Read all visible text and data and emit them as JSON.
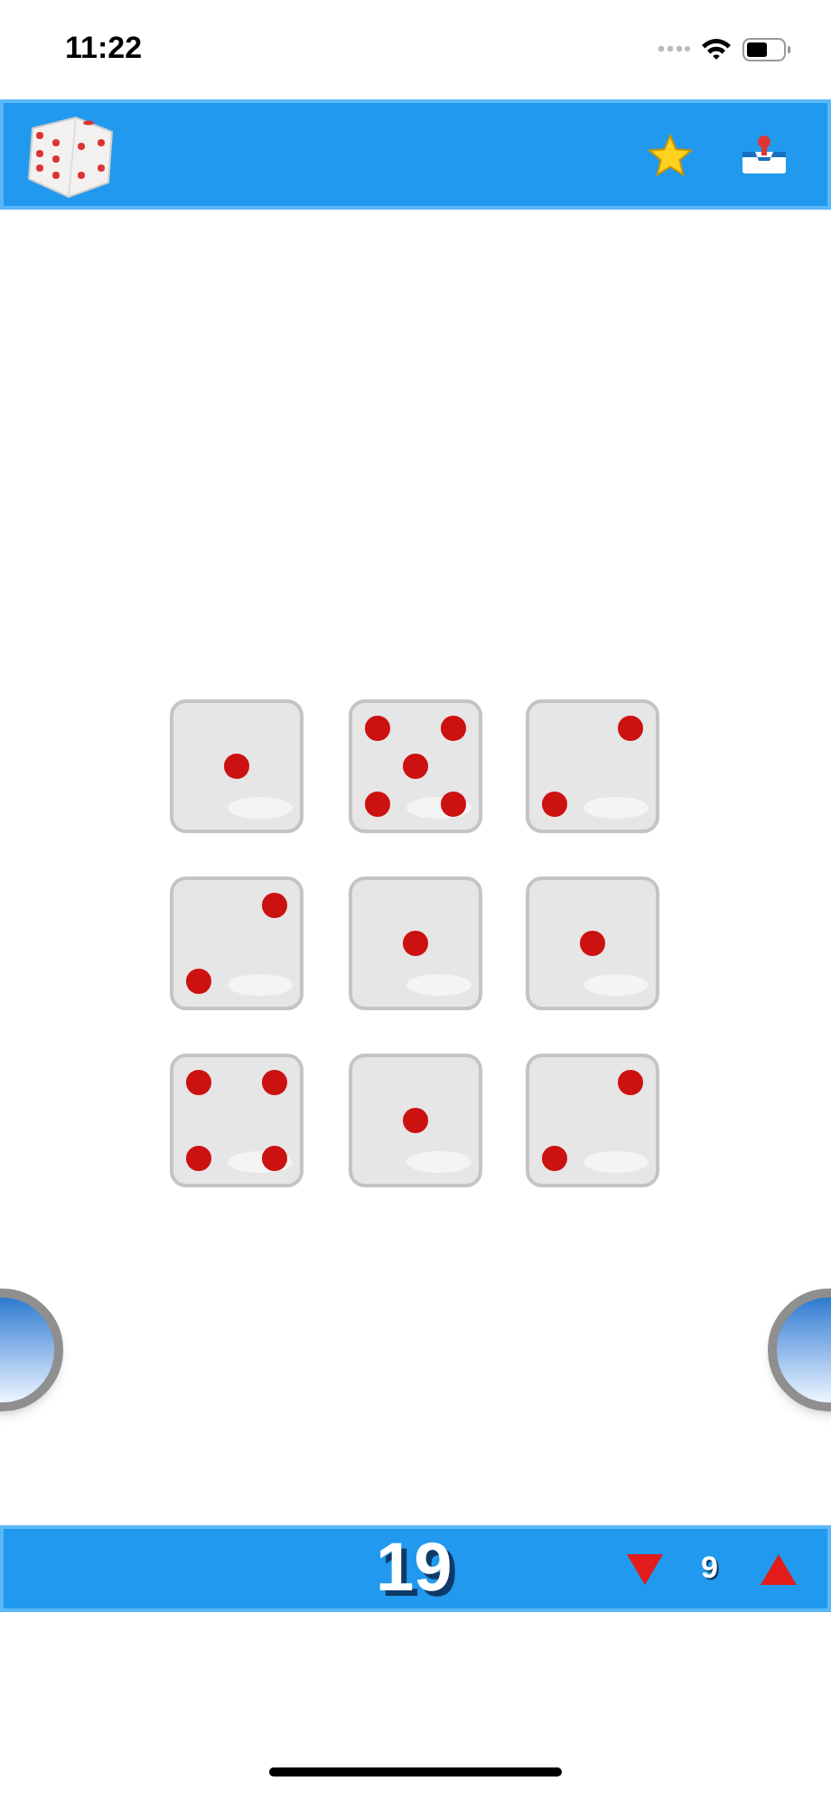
{
  "status_bar": {
    "time": "11:22"
  },
  "dice": [
    {
      "kind": "one"
    },
    {
      "kind": "five"
    },
    {
      "kind": "two"
    },
    {
      "kind": "two"
    },
    {
      "kind": "one"
    },
    {
      "kind": "one"
    },
    {
      "kind": "four"
    },
    {
      "kind": "one"
    },
    {
      "kind": "two"
    }
  ],
  "footer": {
    "total": "19",
    "dice_count": "9"
  }
}
